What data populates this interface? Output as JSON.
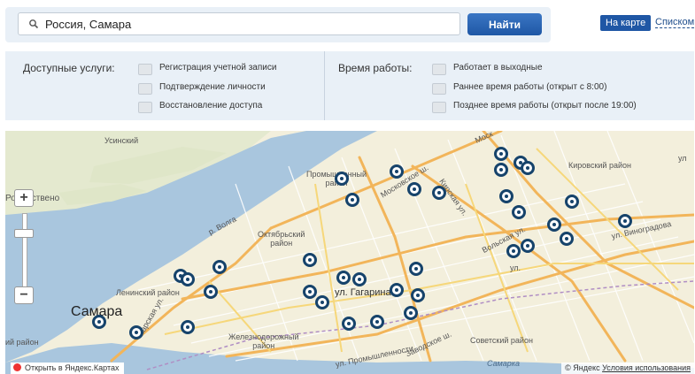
{
  "search": {
    "value": "Россия, Самара",
    "find_label": "Найти"
  },
  "view": {
    "map_label": "На карте",
    "list_label": "Списком"
  },
  "services": {
    "title": "Доступные услуги:",
    "options": [
      {
        "label": "Регистрация учетной записи",
        "checked": false
      },
      {
        "label": "Подтверждение личности",
        "checked": false
      },
      {
        "label": "Восстановление доступа",
        "checked": false
      }
    ]
  },
  "hours": {
    "title": "Время работы:",
    "options": [
      {
        "label": "Работает в выходные",
        "checked": false
      },
      {
        "label": "Раннее время работы (открыт с 8:00)",
        "checked": false
      },
      {
        "label": "Позднее время работы (открыт после 19:00)",
        "checked": false
      }
    ]
  },
  "map": {
    "labels": {
      "usinsky": "Усинский",
      "rozhdestveno": "Рождествено",
      "volga": "р. Волга",
      "promyshlenny": "Промышленный\nрайон",
      "oktyabrsky": "Октябрьский\nрайон",
      "leninsky": "Ленинский район",
      "samara": "Самара",
      "zheleznodorozhny": "Железнодорожный\nрайон",
      "kuibyshevsky": "ий район",
      "kirovsky": "Кировский район",
      "sovetsky": "Советский район",
      "moskovskoe": "Московское ш.",
      "gagarina": "ул. Гагарина",
      "promyshlennosti": "ул. Промышленности",
      "zavodskoe": "Заводское ш.",
      "volskaya": "Вольская ул.",
      "vinogradova": "ул. Виноградова",
      "moskovskoe_top": "Моск",
      "ul_right": "ул",
      "samarka": "Самарка",
      "lenina_road": "Карская ул.",
      "semafornaya": "Кирская ул.",
      "stadium": "ул."
    },
    "zoom_level": 0.75,
    "open_in_yandex": "Открыть в Яндекс.Картах",
    "copyright": "© Яндекс",
    "terms": "Условия использования"
  }
}
